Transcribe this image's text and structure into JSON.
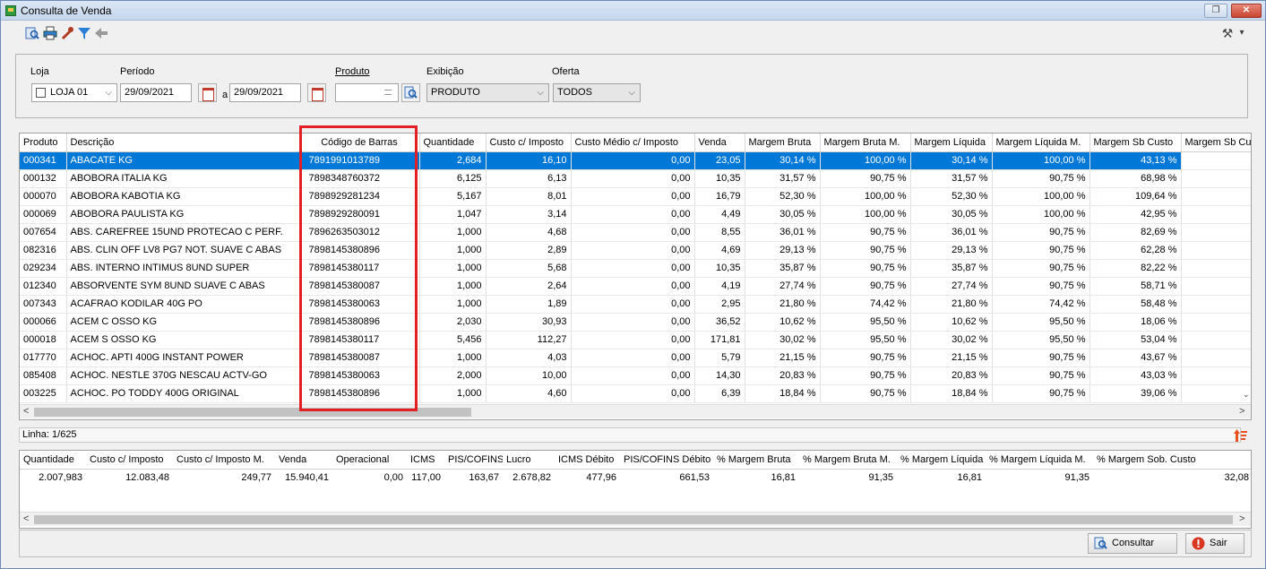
{
  "window": {
    "title": "Consulta de Venda",
    "restore_glyph": "❐",
    "close_glyph": "✕"
  },
  "toolbar": {
    "icons": [
      "search-icon",
      "print-icon",
      "wrench-icon",
      "filter-icon",
      "back-arrow-icon"
    ],
    "tools_icon": "tools-icon",
    "tools_glyph": "⚒",
    "dropdown_glyph": "▾"
  },
  "filters": {
    "loja_label": "Loja",
    "loja_value": "LOJA 01",
    "periodo_label": "Período",
    "date_from": "29/09/2021",
    "date_sep": "a",
    "date_to": "29/09/2021",
    "produto_label": "Produto",
    "produto_value": "",
    "exibicao_label": "Exibição",
    "exibicao_value": "PRODUTO",
    "oferta_label": "Oferta",
    "oferta_value": "TODOS"
  },
  "grid": {
    "columns": [
      "Produto",
      "Descrição",
      "Código de Barras",
      "Quantidade",
      "Custo c/ Imposto",
      "Custo Médio c/ Imposto",
      "Venda",
      "Margem Bruta",
      "Margem Bruta M.",
      "Margem Líquida",
      "Margem Líquida M.",
      "Margem Sb Custo",
      "Margem Sb Cu"
    ],
    "rows": [
      [
        "000341",
        "ABACATE KG",
        "7891991013789",
        "2,684",
        "16,10",
        "0,00",
        "23,05",
        "30,14 %",
        "100,00 %",
        "30,14 %",
        "100,00 %",
        "43,13 %",
        ""
      ],
      [
        "000132",
        "ABOBORA ITALIA KG",
        "7898348760372",
        "6,125",
        "6,13",
        "0,00",
        "10,35",
        "31,57 %",
        "90,75 %",
        "31,57 %",
        "90,75 %",
        "68,98 %",
        ""
      ],
      [
        "000070",
        "ABOBORA KABOTIA KG",
        "7898929281234",
        "5,167",
        "8,01",
        "0,00",
        "16,79",
        "52,30 %",
        "100,00 %",
        "52,30 %",
        "100,00 %",
        "109,64 %",
        ""
      ],
      [
        "000069",
        "ABOBORA PAULISTA KG",
        "7898929280091",
        "1,047",
        "3,14",
        "0,00",
        "4,49",
        "30,05 %",
        "100,00 %",
        "30,05 %",
        "100,00 %",
        "42,95 %",
        ""
      ],
      [
        "007654",
        "ABS. CAREFREE 15UND PROTECAO C PERF.",
        "7896263503012",
        "1,000",
        "4,68",
        "0,00",
        "8,55",
        "36,01 %",
        "90,75 %",
        "36,01 %",
        "90,75 %",
        "82,69 %",
        ""
      ],
      [
        "082316",
        "ABS. CLIN OFF LV8 PG7 NOT. SUAVE C ABAS",
        "7898145380896",
        "1,000",
        "2,89",
        "0,00",
        "4,69",
        "29,13 %",
        "90,75 %",
        "29,13 %",
        "90,75 %",
        "62,28 %",
        ""
      ],
      [
        "029234",
        "ABS. INTERNO INTIMUS 8UND SUPER",
        "7898145380117",
        "1,000",
        "5,68",
        "0,00",
        "10,35",
        "35,87 %",
        "90,75 %",
        "35,87 %",
        "90,75 %",
        "82,22 %",
        ""
      ],
      [
        "012340",
        "ABSORVENTE SYM 8UND SUAVE C ABAS",
        "7898145380087",
        "1,000",
        "2,64",
        "0,00",
        "4,19",
        "27,74 %",
        "90,75 %",
        "27,74 %",
        "90,75 %",
        "58,71 %",
        ""
      ],
      [
        "007343",
        "ACAFRAO KODILAR 40G PO",
        "7898145380063",
        "1,000",
        "1,89",
        "0,00",
        "2,95",
        "21,80 %",
        "74,42 %",
        "21,80 %",
        "74,42 %",
        "58,48 %",
        ""
      ],
      [
        "000066",
        "ACEM C OSSO KG",
        "7898145380896",
        "2,030",
        "30,93",
        "0,00",
        "36,52",
        "10,62 %",
        "95,50 %",
        "10,62 %",
        "95,50 %",
        "18,06 %",
        ""
      ],
      [
        "000018",
        "ACEM S OSSO KG",
        "7898145380117",
        "5,456",
        "112,27",
        "0,00",
        "171,81",
        "30,02 %",
        "95,50 %",
        "30,02 %",
        "95,50 %",
        "53,04 %",
        ""
      ],
      [
        "017770",
        "ACHOC. APTI 400G INSTANT POWER",
        "7898145380087",
        "1,000",
        "4,03",
        "0,00",
        "5,79",
        "21,15 %",
        "90,75 %",
        "21,15 %",
        "90,75 %",
        "43,67 %",
        ""
      ],
      [
        "085408",
        "ACHOC. NESTLE 370G NESCAU ACTV-GO",
        "7898145380063",
        "2,000",
        "10,00",
        "0,00",
        "14,30",
        "20,83 %",
        "90,75 %",
        "20,83 %",
        "90,75 %",
        "43,03 %",
        ""
      ],
      [
        "003225",
        "ACHOC. PO TODDY 400G ORIGINAL",
        "7898145380896",
        "1,000",
        "4,60",
        "0,00",
        "6,39",
        "18,84 %",
        "90,75 %",
        "18,84 %",
        "90,75 %",
        "39,06 %",
        ""
      ]
    ]
  },
  "status": {
    "linha": "Linha: 1/625"
  },
  "summary": {
    "columns": [
      "Quantidade",
      "Custo c/ Imposto",
      "Custo c/ Imposto M.",
      "Venda",
      "Operacional",
      "ICMS",
      "PIS/COFINS",
      "Lucro",
      "ICMS Débito",
      "PIS/COFINS Débito",
      "% Margem Bruta",
      "% Margem Bruta M.",
      "% Margem Líquida",
      "% Margem Líquida M.",
      "% Margem Sob. Custo"
    ],
    "values": [
      "2.007,983",
      "12.083,48",
      "249,77",
      "15.940,41",
      "0,00",
      "117,00",
      "163,67",
      "2.678,82",
      "477,96",
      "661,53",
      "16,81",
      "91,35",
      "16,81",
      "91,35",
      "32,08"
    ]
  },
  "scroll": {
    "left": "<",
    "right": ">",
    "down": "⌄"
  },
  "buttons": {
    "consultar": "Consultar",
    "sair": "Sair"
  },
  "colors": {
    "selection": "#0078d7",
    "highlight_box": "#e31e24"
  }
}
